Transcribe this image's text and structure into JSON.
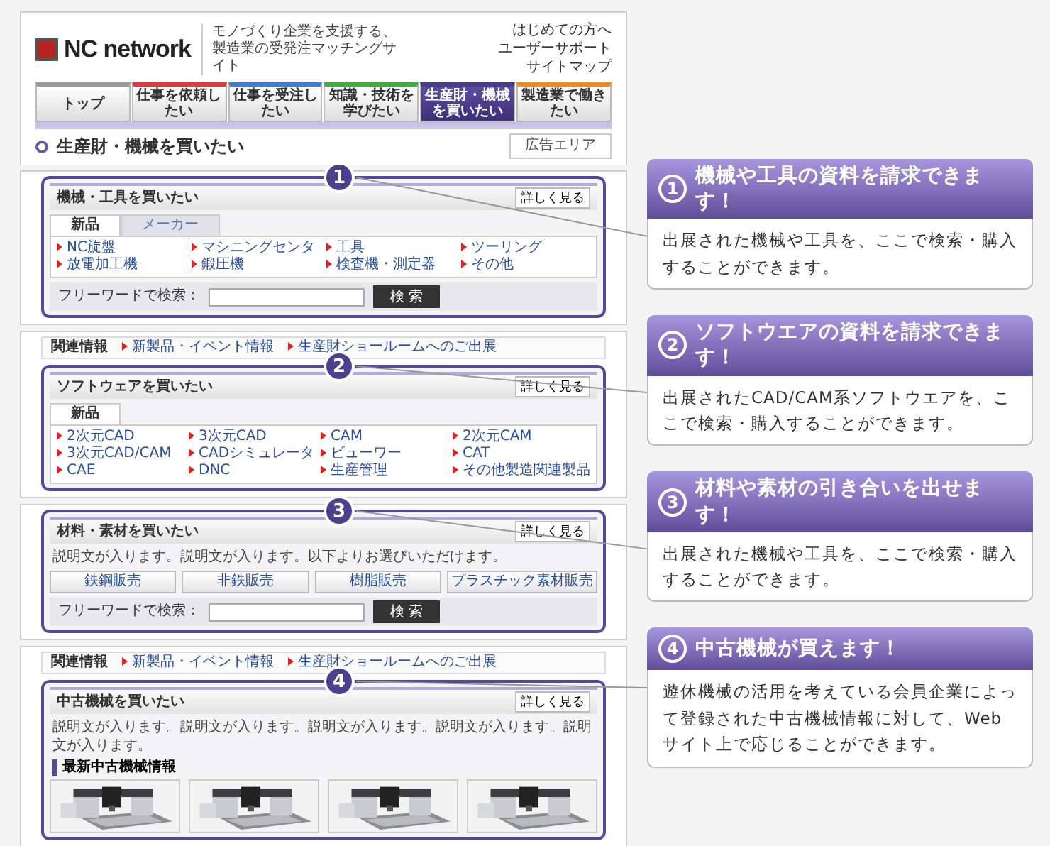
{
  "site": {
    "logo": "NC network",
    "tagline": "モノづくり企業を支援する、製造業の受発注マッチングサイト",
    "links": [
      "はじめての方へ",
      "ユーザーサポート",
      "サイトマップ"
    ]
  },
  "nav": [
    {
      "label": "トップ",
      "selected": false,
      "color": "#9a9a9a"
    },
    {
      "label": "仕事を依頼したい",
      "selected": false,
      "color": "#e03a3a"
    },
    {
      "label": "仕事を受注したい",
      "selected": false,
      "color": "#3a7fd0"
    },
    {
      "label": "知識・技術を学びたい",
      "selected": false,
      "color": "#3fae3f"
    },
    {
      "label": "生産財・機械を買いたい",
      "selected": true,
      "color": "#4a3a8a"
    },
    {
      "label": "製造業で働きたい",
      "selected": false,
      "color": "#f08a20"
    }
  ],
  "page_title": "生産財・機械を買いたい",
  "ad": "広告エリア",
  "sections": [
    {
      "kind": "links",
      "number": "1",
      "title": "機械・工具を買いたい",
      "more": "詳しく見る",
      "tabs": [
        {
          "label": "新品",
          "selected": true
        },
        {
          "label": "メーカー",
          "selected": false
        }
      ],
      "links": [
        "NC旋盤",
        "マシニングセンタ",
        "工具",
        "ツーリング",
        "放電加工機",
        "鍛圧機",
        "検査機・測定器",
        "その他"
      ],
      "search": {
        "label": "フリーワードで検索：",
        "button": "検 索"
      }
    },
    {
      "kind": "links",
      "number": "2",
      "related": {
        "label": "関連情報",
        "links": [
          "新製品・イベント情報",
          "生産財ショールームへのご出展"
        ]
      },
      "title": "ソフトウェアを買いたい",
      "more": "詳しく見る",
      "tabs": [
        {
          "label": "新品",
          "selected": true
        }
      ],
      "links": [
        "2次元CAD",
        "3次元CAD",
        "CAM",
        "2次元CAM",
        "3次元CAD/CAM",
        "CADシミュレータ",
        "ビューワー",
        "CAT",
        "CAE",
        "DNC",
        "生産管理",
        "その他製造関連製品"
      ]
    },
    {
      "kind": "buttons",
      "number": "3",
      "title": "材料・素材を買いたい",
      "more": "詳しく見る",
      "description": "説明文が入ります。説明文が入ります。以下よりお選びいただけます。",
      "buttons": [
        "鉄鋼販売",
        "非鉄販売",
        "樹脂販売",
        "プラスチック素材販売"
      ],
      "search": {
        "label": "フリーワードで検索：",
        "button": "検 索"
      }
    },
    {
      "kind": "gallery",
      "number": "4",
      "related": {
        "label": "関連情報",
        "links": [
          "新製品・イベント情報",
          "生産財ショールームへのご出展"
        ]
      },
      "title": "中古機械を買いたい",
      "more": "詳しく見る",
      "description": "説明文が入ります。説明文が入ります。説明文が入ります。説明文が入ります。説明文が入ります。",
      "subheading": "最新中古機械情報"
    }
  ],
  "callouts": [
    {
      "number": "1",
      "title": "機械や工具の資料を請求できます！",
      "body": "出展された機械や工具を、ここで検索・購入することができます。"
    },
    {
      "number": "2",
      "title": "ソフトウエアの資料を請求できます！",
      "body": "出展されたCAD/CAM系ソフトウエアを、ここで検索・購入することができます。"
    },
    {
      "number": "3",
      "title": "材料や素材の引き合いを出せます！",
      "body": "出展された機械や工具を、ここで検索・購入することができます。"
    },
    {
      "number": "4",
      "title": "中古機械が買えます！",
      "body": "遊休機械の活用を考えている会員企業によって登録された中古機械情報に対して、Webサイト上で応じることができます。"
    }
  ]
}
